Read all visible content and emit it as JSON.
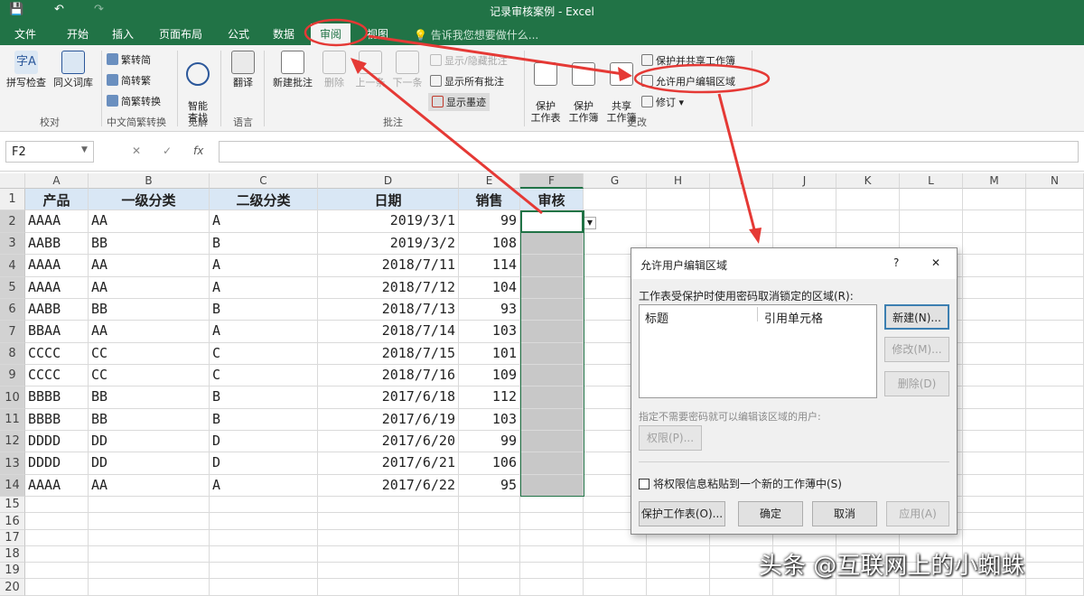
{
  "app": {
    "title": "记录审核案例 - Excel"
  },
  "tabs": [
    "文件",
    "开始",
    "插入",
    "页面布局",
    "公式",
    "数据",
    "审阅",
    "视图"
  ],
  "tell_me": "告诉我您想要做什么...",
  "ribbon": {
    "proofing": {
      "spell": "拼写检查",
      "thesaurus": "同义词库",
      "label": "校对"
    },
    "chinese": {
      "t2s": "繁转简",
      "s2t": "简转繁",
      "convert": "简繁转换",
      "label": "中文简繁转换"
    },
    "insights": {
      "smart": "智能\n查找",
      "label": "见解"
    },
    "language": {
      "translate": "翻译",
      "label": "语言"
    },
    "comments": {
      "new": "新建批注",
      "delete": "删除",
      "prev": "上一条",
      "next": "下一条",
      "show_hide": "显示/隐藏批注",
      "show_all": "显示所有批注",
      "show_ink": "显示墨迹",
      "label": "批注"
    },
    "changes": {
      "protect_sheet": "保护\n工作表",
      "protect_book": "保护\n工作簿",
      "share_book": "共享\n工作簿",
      "protect_share": "保护并共享工作簿",
      "allow_edit": "允许用户编辑区域",
      "track": "修订",
      "label": "更改"
    }
  },
  "formula_bar": {
    "name_box": "F2",
    "cancel": "✕",
    "enter": "✓",
    "fx": "fx"
  },
  "columns": [
    "A",
    "B",
    "C",
    "D",
    "E",
    "F",
    "G",
    "H",
    "I",
    "J",
    "K",
    "L",
    "M",
    "N"
  ],
  "headers": [
    "产品",
    "一级分类",
    "二级分类",
    "日期",
    "销售",
    "审核"
  ],
  "rows": [
    [
      "AAAA",
      "AA",
      "A",
      "2019/3/1",
      "99"
    ],
    [
      "AABB",
      "BB",
      "B",
      "2019/3/2",
      "108"
    ],
    [
      "AAAA",
      "AA",
      "A",
      "2018/7/11",
      "114"
    ],
    [
      "AAAA",
      "AA",
      "A",
      "2018/7/12",
      "104"
    ],
    [
      "AABB",
      "BB",
      "B",
      "2018/7/13",
      "93"
    ],
    [
      "BBAA",
      "AA",
      "A",
      "2018/7/14",
      "103"
    ],
    [
      "CCCC",
      "CC",
      "C",
      "2018/7/15",
      "101"
    ],
    [
      "CCCC",
      "CC",
      "C",
      "2018/7/16",
      "109"
    ],
    [
      "BBBB",
      "BB",
      "B",
      "2017/6/18",
      "112"
    ],
    [
      "BBBB",
      "BB",
      "B",
      "2017/6/19",
      "103"
    ],
    [
      "DDDD",
      "DD",
      "D",
      "2017/6/20",
      "99"
    ],
    [
      "DDDD",
      "DD",
      "D",
      "2017/6/21",
      "106"
    ],
    [
      "AAAA",
      "AA",
      "A",
      "2017/6/22",
      "95"
    ]
  ],
  "row_numbers": [
    "1",
    "2",
    "3",
    "4",
    "5",
    "6",
    "7",
    "8",
    "9",
    "10",
    "11",
    "12",
    "13",
    "14",
    "15",
    "16",
    "17",
    "18",
    "19",
    "20"
  ],
  "dialog": {
    "title": "允许用户编辑区域",
    "help": "?",
    "close": "✕",
    "ranges_label": "工作表受保护时使用密码取消锁定的区域(R):",
    "col_title": "标题",
    "col_ref": "引用单元格",
    "new": "新建(N)...",
    "modify": "修改(M)...",
    "delete": "删除(D)",
    "users_label": "指定不需要密码就可以编辑该区域的用户:",
    "permissions": "权限(P)...",
    "paste_info": "将权限信息粘贴到一个新的工作薄中(S)",
    "protect": "保护工作表(O)...",
    "ok": "确定",
    "cancel": "取消",
    "apply": "应用(A)"
  },
  "watermark": "头条 @互联网上的小蜘蛛",
  "colors": {
    "excel_green": "#217346",
    "header_fill": "#d9e7f5",
    "locked_fill": "#c8c8c8",
    "annotation": "#e53935"
  }
}
